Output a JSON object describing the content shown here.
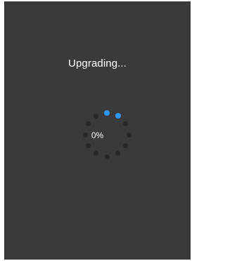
{
  "dialog": {
    "title": "Upgrading...",
    "progress_text": "0%",
    "progress_value": 0,
    "spinner": {
      "dot_count": 12,
      "active_dots": [
        0,
        1
      ],
      "active_color": "#2f95f1",
      "inactive_color": "#262628"
    },
    "background_color": "#3a3a3d"
  }
}
